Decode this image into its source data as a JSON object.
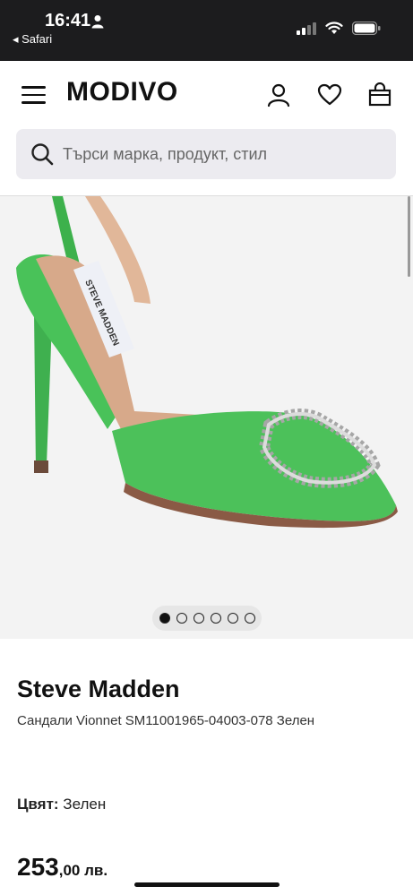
{
  "status_bar": {
    "time": "16:41",
    "back_app": "◂ Safari"
  },
  "header": {
    "logo": "MODIVO",
    "icons": [
      "menu-icon",
      "user-icon",
      "heart-icon",
      "bag-icon"
    ]
  },
  "search": {
    "placeholder": "Търси марка, продукт, стил"
  },
  "gallery": {
    "image_count": 6,
    "active_index": 0,
    "image_description_colors": {
      "shoe": "#4cc15a",
      "background": "#f3f3f3"
    }
  },
  "product": {
    "brand": "Steve Madden",
    "name": "Сандали Vionnet SM11001965-04003-078 Зелен",
    "color_label": "Цвят:",
    "color_value": "Зелен",
    "price_main": "253",
    "price_rest": ",00 лв."
  }
}
